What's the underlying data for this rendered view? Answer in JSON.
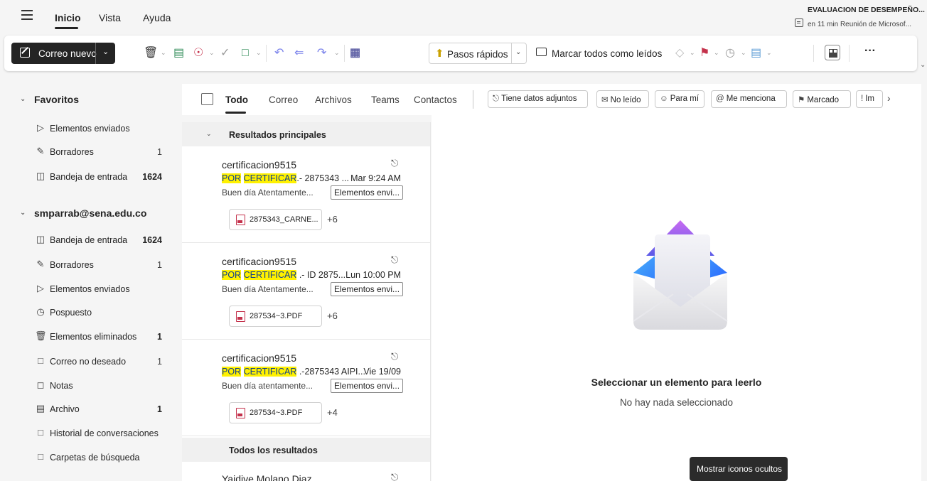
{
  "nav": {
    "tabs": [
      "Inicio",
      "Vista",
      "Ayuda"
    ],
    "reminder_title": "EVALUACION DE DESEMPEÑO...",
    "reminder_sub": "en 11 min Reunión de Microsof..."
  },
  "ribbon": {
    "new_mail": "Correo nuevo",
    "pasos": "Pasos rápidos",
    "mark_all_read": "Marcar todos como leídos",
    "more": "···"
  },
  "sidebar": {
    "favorites": {
      "title": "Favoritos",
      "items": [
        {
          "label": "Elementos enviados",
          "count": "",
          "icon": "send-icon"
        },
        {
          "label": "Borradores",
          "count": "1",
          "icon": "draft-icon"
        },
        {
          "label": "Bandeja de entrada",
          "count": "1624",
          "icon": "inbox-icon"
        }
      ]
    },
    "account": {
      "title": "smparrab@sena.edu.co",
      "items": [
        {
          "label": "Bandeja de entrada",
          "count": "1624",
          "icon": "inbox-icon"
        },
        {
          "label": "Borradores",
          "count": "1",
          "icon": "draft-icon"
        },
        {
          "label": "Elementos enviados",
          "count": "",
          "icon": "send-icon"
        },
        {
          "label": "Pospuesto",
          "count": "",
          "icon": "clock-icon"
        },
        {
          "label": "Elementos eliminados",
          "count": "1",
          "icon": "trash-icon"
        },
        {
          "label": "Correo no deseado",
          "count": "1",
          "icon": "junk-icon"
        },
        {
          "label": "Notas",
          "count": "",
          "icon": "note-icon"
        },
        {
          "label": "Archivo",
          "count": "1",
          "icon": "archive-icon"
        },
        {
          "label": "Historial de conversaciones",
          "count": "",
          "icon": "folder-icon"
        },
        {
          "label": "Carpetas de búsqueda",
          "count": "",
          "icon": "search-folder-icon"
        }
      ]
    }
  },
  "filters": {
    "tabs": [
      "Todo",
      "Correo",
      "Archivos",
      "Teams",
      "Contactos"
    ],
    "chips": [
      "Tiene datos adjuntos",
      "No leído",
      "Para mí",
      "Me menciona",
      "Marcado",
      "Im"
    ]
  },
  "list": {
    "group_top": "Resultados principales",
    "group_all": "Todos los resultados",
    "messages": [
      {
        "sender": "certificacion9515",
        "hl1": "POR",
        "hl2": "CERTIFICAR",
        "subject_rest": ".- 2875343 ...",
        "time": "Mar 9:24 AM",
        "preview": "Buen día Atentamente...",
        "folder": "Elementos envi...",
        "attachment": "2875343_CARNE...",
        "more": "+6"
      },
      {
        "sender": "certificacion9515",
        "hl1": "POR",
        "hl2": "CERTIFICAR",
        "subject_rest": " .- ID 2875...",
        "time": "Lun 10:00 PM",
        "preview": "Buen día Atentamente...",
        "folder": "Elementos envi...",
        "attachment": "287534~3.PDF",
        "more": "+6"
      },
      {
        "sender": "certificacion9515",
        "hl1": "POR",
        "hl2": "CERTIFICAR",
        "subject_rest": " .-2875343 AIPI...",
        "time": "Vie 19/09",
        "preview": "Buen día atentamente...",
        "folder": "Elementos envi...",
        "attachment": "287534~3.PDF",
        "more": "+4"
      }
    ],
    "partial_sender": "Yaidive Molano Diaz"
  },
  "reading": {
    "title": "Seleccionar un elemento para leerlo",
    "sub": "No hay nada seleccionado"
  },
  "tooltip": "Mostrar iconos ocultos"
}
